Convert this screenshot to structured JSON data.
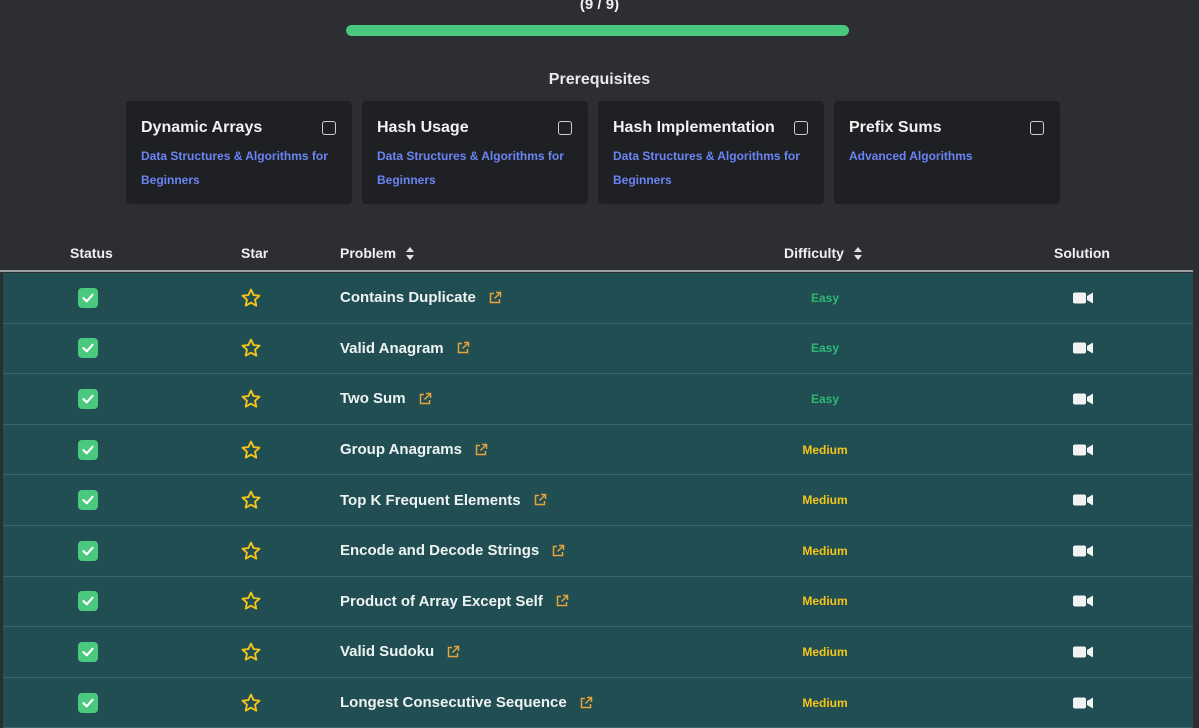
{
  "progress": {
    "label": "(9 / 9)",
    "value": 1.0,
    "color": "#4ac87e"
  },
  "prerequisites": {
    "title": "Prerequisites",
    "cards": [
      {
        "title": "Dynamic Arrays",
        "course": "Data Structures & Algorithms for Beginners"
      },
      {
        "title": "Hash Usage",
        "course": "Data Structures & Algorithms for Beginners"
      },
      {
        "title": "Hash Implementation",
        "course": "Data Structures & Algorithms for Beginners"
      },
      {
        "title": "Prefix Sums",
        "course": "Advanced Algorithms"
      }
    ]
  },
  "table": {
    "headers": {
      "status": "Status",
      "star": "Star",
      "problem": "Problem",
      "difficulty": "Difficulty",
      "solution": "Solution"
    },
    "rows": [
      {
        "problem": "Contains Duplicate",
        "difficulty": "Easy",
        "done": true
      },
      {
        "problem": "Valid Anagram",
        "difficulty": "Easy",
        "done": true
      },
      {
        "problem": "Two Sum",
        "difficulty": "Easy",
        "done": true
      },
      {
        "problem": "Group Anagrams",
        "difficulty": "Medium",
        "done": true
      },
      {
        "problem": "Top K Frequent Elements",
        "difficulty": "Medium",
        "done": true
      },
      {
        "problem": "Encode and Decode Strings",
        "difficulty": "Medium",
        "done": true
      },
      {
        "problem": "Product of Array Except Self",
        "difficulty": "Medium",
        "done": true
      },
      {
        "problem": "Valid Sudoku",
        "difficulty": "Medium",
        "done": true
      },
      {
        "problem": "Longest Consecutive Sequence",
        "difficulty": "Medium",
        "done": true
      }
    ]
  },
  "colors": {
    "easy": "#2fb874",
    "medium": "#f5c518",
    "row_bg": "#214e52",
    "link_icon": "#e6a23c",
    "star": "#f5c518"
  }
}
